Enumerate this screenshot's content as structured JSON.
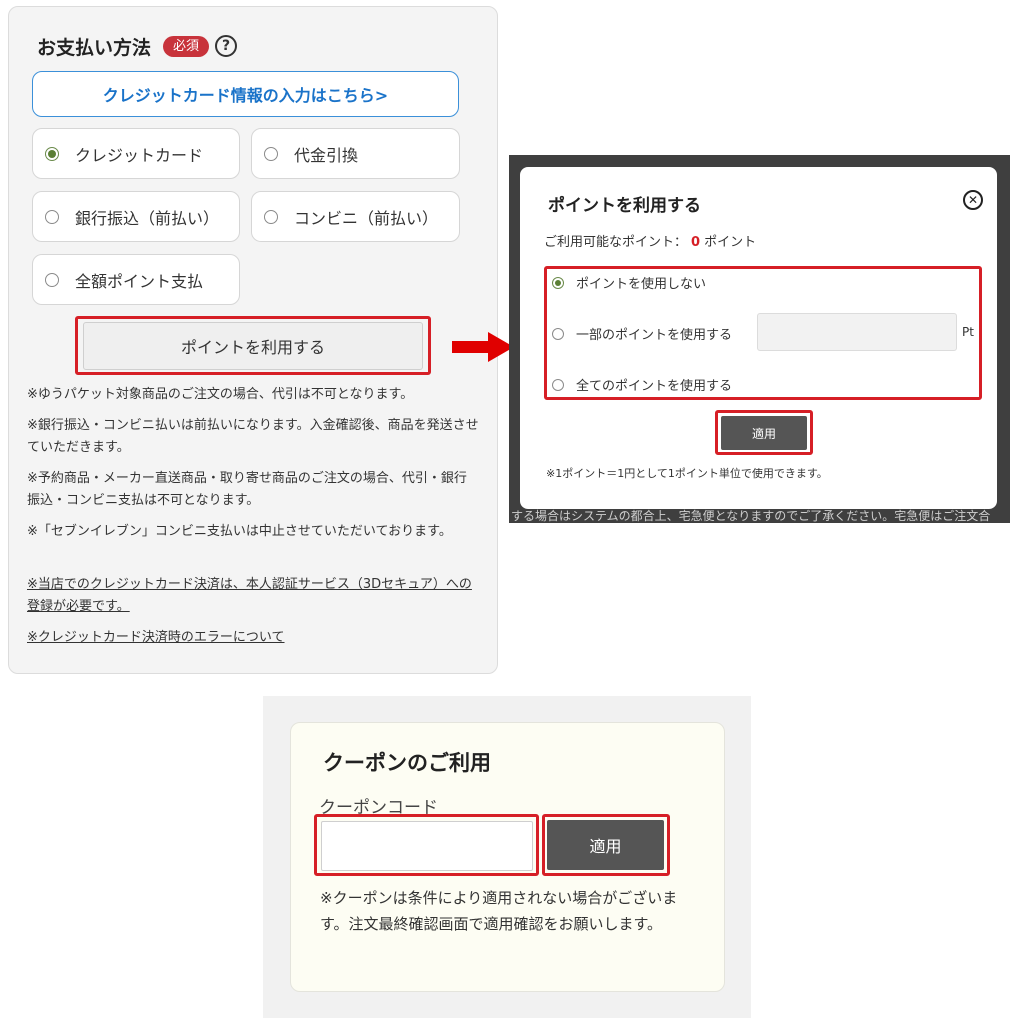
{
  "payment": {
    "title": "お支払い方法",
    "required_badge": "必須",
    "help_icon": "?",
    "credit_link": "クレジットカード情報の入力はこちら>",
    "options": [
      {
        "label": "クレジットカード",
        "selected": true
      },
      {
        "label": "代金引換",
        "selected": false
      },
      {
        "label": "銀行振込（前払い）",
        "selected": false
      },
      {
        "label": "コンビニ（前払い）",
        "selected": false
      },
      {
        "label": "全額ポイント支払",
        "selected": false
      }
    ],
    "points_button": "ポイントを利用する",
    "notes": [
      "※ゆうパケット対象商品のご注文の場合、代引は不可となります。",
      "※銀行振込・コンビニ払いは前払いになります。入金確認後、商品を発送させていただきます。",
      "※予約商品・メーカー直送商品・取り寄せ商品のご注文の場合、代引・銀行振込・コンビニ支払は不可となります。",
      "※「セブンイレブン」コンビニ支払いは中止させていただいております。"
    ],
    "links": [
      "※当店でのクレジットカード決済は、本人認証サービス（3Dセキュア）への登録が必要です。",
      "※クレジットカード決済時のエラーについて"
    ]
  },
  "modal": {
    "title": "ポイントを利用する",
    "available_prefix": "ご利用可能なポイント：",
    "available_value": "0",
    "available_suffix": "ポイント",
    "options": [
      {
        "label": "ポイントを使用しない",
        "selected": true
      },
      {
        "label": "一部のポイントを使用する",
        "selected": false
      },
      {
        "label": "全てのポイントを使用する",
        "selected": false
      }
    ],
    "unit": "Pt",
    "apply_button": "適用",
    "footnote": "※1ポイント＝1円として1ポイント単位で使用できます。",
    "background_text": "する場合はシステムの都合上、宅急便となりますのでご了承ください。宅急便はご注文合"
  },
  "coupon": {
    "title": "クーポンのご利用",
    "code_label": "クーポンコード",
    "input_value": "",
    "apply_button": "適用",
    "note": "※クーポンは条件により適用されない場合がございます。注文最終確認画面で適用確認をお願いします。"
  },
  "colors": {
    "highlight_red": "#d61f26",
    "link_blue": "#1a73c9",
    "required_red": "#c8333b",
    "button_dark": "#555555",
    "radio_green": "#5b7f35"
  }
}
